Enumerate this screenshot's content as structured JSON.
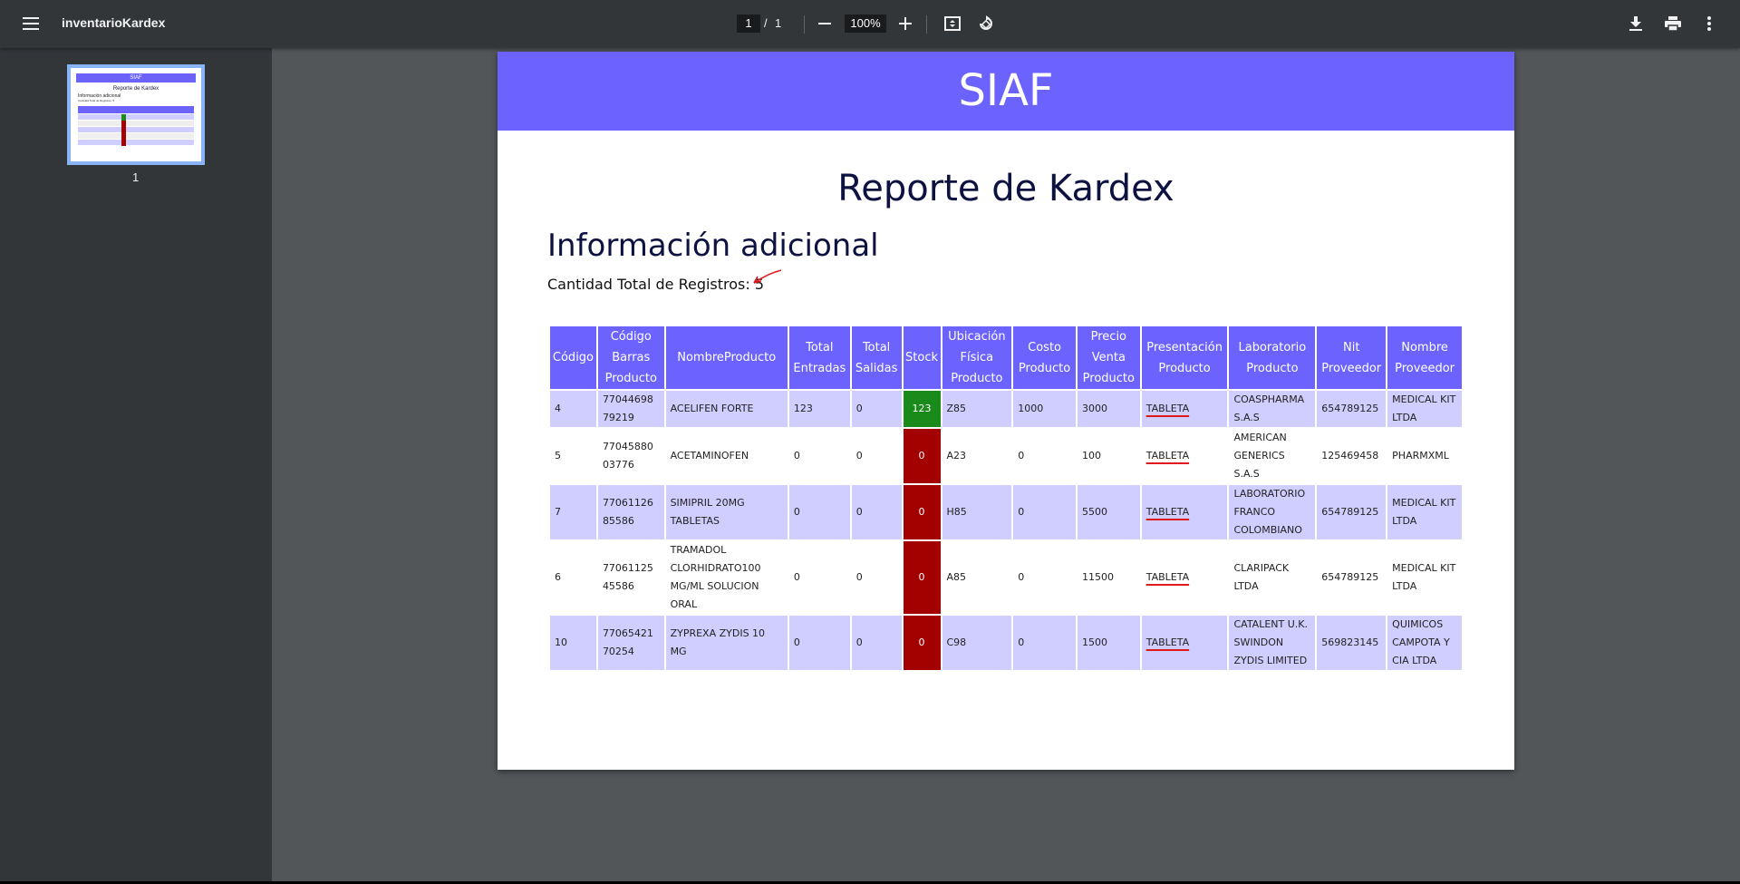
{
  "toolbar": {
    "title": "inventarioKardex",
    "current_page": "1",
    "page_separator": "/",
    "total_pages": "1",
    "zoom": "100%",
    "icons": [
      "menu-icon",
      "zoom-out-icon",
      "zoom-in-icon",
      "fit-page-icon",
      "rotate-icon",
      "download-icon",
      "print-icon",
      "more-icon"
    ]
  },
  "sidebar": {
    "thumbnail_label": "1"
  },
  "report": {
    "banner": "SIAF",
    "title": "Reporte de Kardex",
    "info_title": "Información adicional",
    "count_label": "Cantidad Total de Registros: 5",
    "headers": [
      "Código",
      "Código Barras Producto",
      "NombreProducto",
      "Total Entradas",
      "Total Salidas",
      "Stock",
      "Ubicación Física Producto",
      "Costo Producto",
      "Precio Venta Producto",
      "Presentación Producto",
      "Laboratorio Producto",
      "Nit Proveedor",
      "Nombre Proveedor"
    ],
    "rows": [
      [
        "4",
        "7704469879219",
        "ACELIFEN FORTE",
        "123",
        "0",
        "123",
        "Z85",
        "1000",
        "3000",
        "TABLETA",
        "COASPHARMA S.A.S",
        "654789125",
        "MEDICAL KIT LTDA"
      ],
      [
        "5",
        "7704588003776",
        "ACETAMINOFEN",
        "0",
        "0",
        "0",
        "A23",
        "0",
        "100",
        "TABLETA",
        "AMERICAN GENERICS S.A.S",
        "125469458",
        "PHARMXML"
      ],
      [
        "7",
        "7706112685586",
        "SIMIPRIL 20MG TABLETAS",
        "0",
        "0",
        "0",
        "H85",
        "0",
        "5500",
        "TABLETA",
        "LABORATORIO FRANCO COLOMBIANO",
        "654789125",
        "MEDICAL KIT LTDA"
      ],
      [
        "6",
        "7706112545586",
        "TRAMADOL CLORHIDRATO100 MG/ML SOLUCION ORAL",
        "0",
        "0",
        "0",
        "A85",
        "0",
        "11500",
        "TABLETA",
        "CLARIPACK LTDA",
        "654789125",
        "MEDICAL KIT LTDA"
      ],
      [
        "10",
        "7706542170254",
        "ZYPREXA ZYDIS 10 MG",
        "0",
        "0",
        "0",
        "C98",
        "0",
        "1500",
        "TABLETA",
        "CATALENT U.K. SWINDON ZYDIS LIMITED",
        "569823145",
        "QUIMICOS CAMPOTA Y CIA LTDA"
      ]
    ]
  },
  "colors": {
    "banner": "#6c63ff",
    "row_alt": "#d0cdff",
    "stock_ok": "#1a8a1a",
    "stock_zero": "#a30000",
    "annotation": "#e0191d"
  }
}
